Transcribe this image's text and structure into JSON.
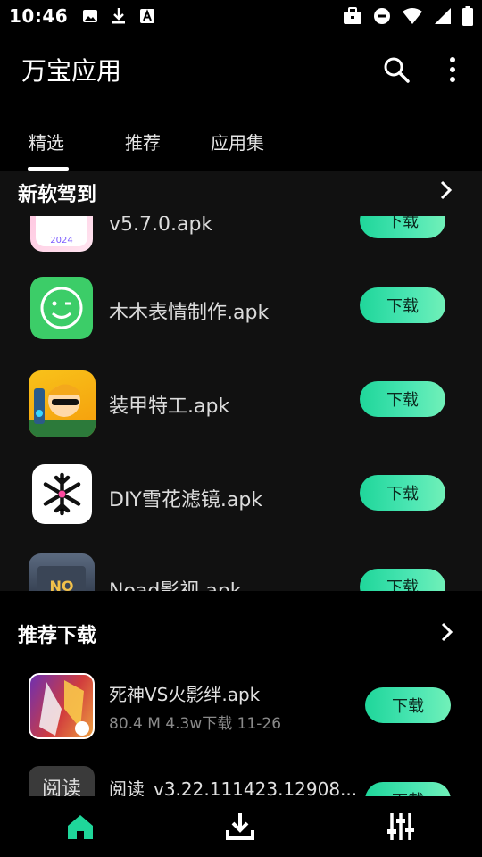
{
  "status_bar": {
    "time": "10:46",
    "left_icons": [
      "image-icon",
      "download-icon",
      "keyboard-a-icon"
    ],
    "right_icons": [
      "briefcase-icon",
      "dnd-icon",
      "wifi-icon",
      "signal-icon",
      "battery-icon"
    ]
  },
  "app_bar": {
    "title": "万宝应用",
    "search_icon": "search-icon",
    "more_icon": "more-vert-icon"
  },
  "tabs": [
    {
      "label": "精选",
      "selected": true
    },
    {
      "label": "推荐",
      "selected": false
    },
    {
      "label": "应用集",
      "selected": false
    }
  ],
  "section_new": {
    "title": "新软驾到",
    "apps": [
      {
        "name": "v5.7.0.apk",
        "button": "下载",
        "icon": "calendar-2024-icon"
      },
      {
        "name": "木木表情制作.apk",
        "button": "下载",
        "icon": "wink-face-icon"
      },
      {
        "name": "装甲特工.apk",
        "button": "下载",
        "icon": "game-character-icon"
      },
      {
        "name": "DIY雪花滤镜.apk",
        "button": "下载",
        "icon": "snowflake-icon"
      },
      {
        "name": "Noad影视.apk",
        "button": "下载",
        "icon": "noad-video-icon"
      }
    ]
  },
  "section_recommend": {
    "title": "推荐下载",
    "apps": [
      {
        "name": "死神VS火影绊.apk",
        "meta": "80.4 M  4.3w下载  11-26",
        "button": "下载",
        "icon": "anime-game-icon"
      },
      {
        "name": "阅读_v3.22.111423.12908...",
        "meta": "",
        "button": "下载",
        "icon": "reading-icon",
        "icon_label": "阅读"
      }
    ]
  },
  "bottom_nav": [
    {
      "name": "home-icon",
      "active": true
    },
    {
      "name": "download-icon",
      "active": false
    },
    {
      "name": "settings-sliders-icon",
      "active": false
    }
  ],
  "colors": {
    "accent": "#1fd69a",
    "active_nav": "#1fd69a"
  }
}
